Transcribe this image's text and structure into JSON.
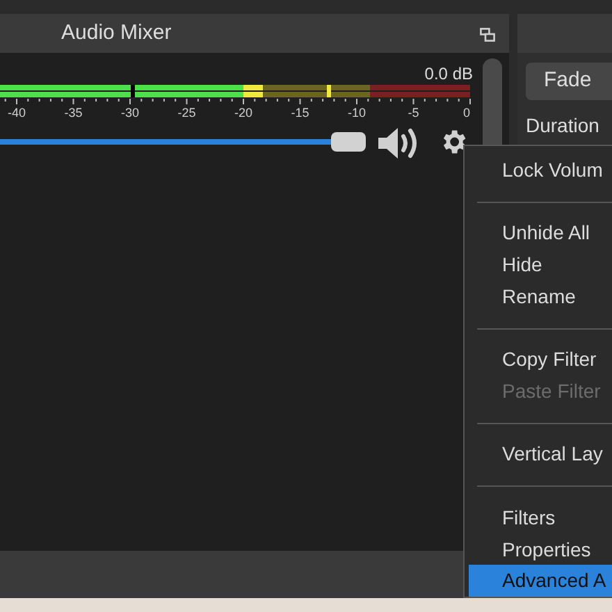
{
  "audio_mixer": {
    "title": "Audio Mixer",
    "meter": {
      "reading": "0.0 dB",
      "level": 0.56,
      "ticks": [
        "-40",
        "-35",
        "-30",
        "-25",
        "-20",
        "-15",
        "-10",
        "-5",
        "0"
      ]
    },
    "volume": {
      "level": 1.0,
      "muted": false
    }
  },
  "transition_panel": {
    "type_button": "Fade",
    "duration_label": "Duration"
  },
  "context_menu": [
    {
      "kind": "item",
      "label": "Lock Volum",
      "disabled": false,
      "selected": false
    },
    {
      "kind": "separator"
    },
    {
      "kind": "item",
      "label": "Unhide All",
      "disabled": false,
      "selected": false
    },
    {
      "kind": "item",
      "label": "Hide",
      "disabled": false,
      "selected": false
    },
    {
      "kind": "item",
      "label": "Rename",
      "disabled": false,
      "selected": false
    },
    {
      "kind": "separator"
    },
    {
      "kind": "item",
      "label": "Copy Filter",
      "disabled": false,
      "selected": false
    },
    {
      "kind": "item",
      "label": "Paste Filter",
      "disabled": true,
      "selected": false
    },
    {
      "kind": "separator"
    },
    {
      "kind": "item",
      "label": "Vertical Lay",
      "disabled": false,
      "selected": false
    },
    {
      "kind": "separator"
    },
    {
      "kind": "item",
      "label": "Filters",
      "disabled": false,
      "selected": false
    },
    {
      "kind": "item",
      "label": "Properties",
      "disabled": false,
      "selected": false
    },
    {
      "kind": "item",
      "label": "Advanced A",
      "disabled": false,
      "selected": true
    }
  ]
}
